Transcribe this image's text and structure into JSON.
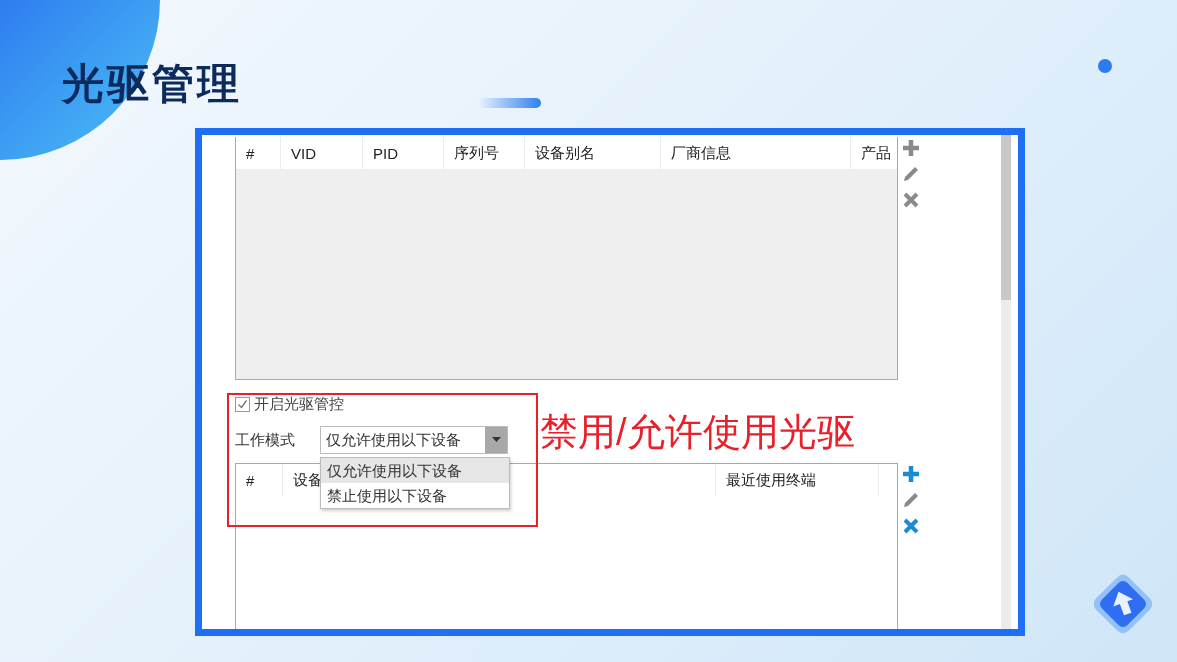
{
  "title": "光驱管理",
  "device_table": {
    "columns": [
      "#",
      "VID",
      "PID",
      "序列号",
      "设备别名",
      "厂商信息",
      "产品"
    ]
  },
  "device_tools": [
    {
      "kind": "add",
      "disabled": true
    },
    {
      "kind": "edit",
      "disabled": true
    },
    {
      "kind": "delete",
      "disabled": true
    }
  ],
  "enable_control": {
    "label": "开启光驱管控",
    "checked": true
  },
  "work_mode": {
    "label": "工作模式",
    "value": "仅允许使用以下设备",
    "expanded": true,
    "options": [
      {
        "label": "仅允许使用以下设备",
        "selected": true
      },
      {
        "label": "禁止使用以下设备",
        "selected": false
      }
    ]
  },
  "list_table": {
    "columns": [
      "#",
      "设备",
      "最近使用终端"
    ]
  },
  "list_tools": [
    {
      "kind": "add",
      "disabled": false
    },
    {
      "kind": "edit",
      "disabled": true
    },
    {
      "kind": "delete",
      "disabled": false
    }
  ],
  "annotation": "禁用/允许使用光驱"
}
